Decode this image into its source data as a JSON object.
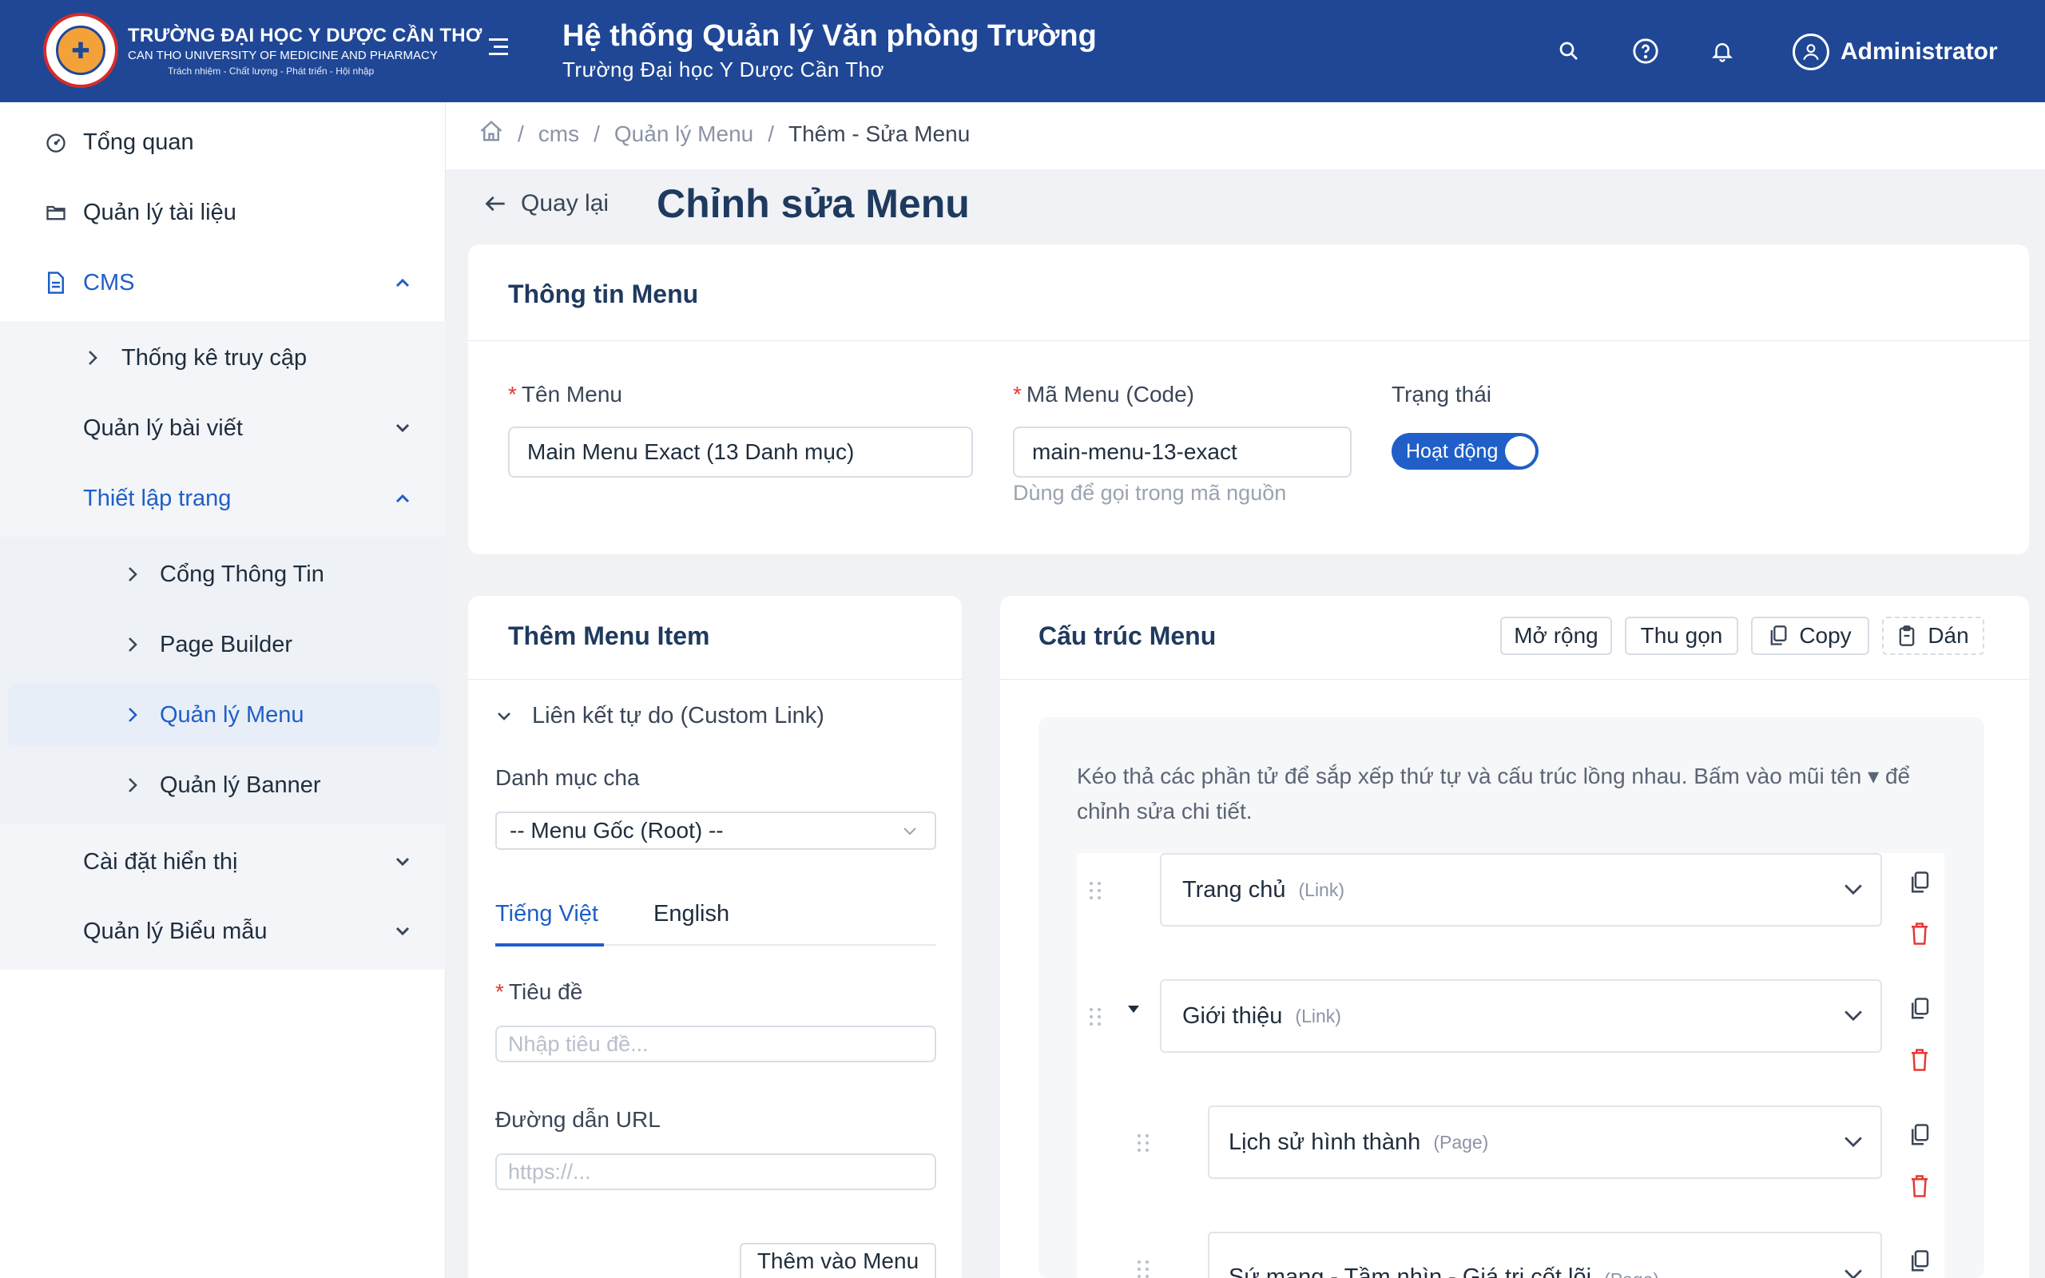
{
  "header": {
    "logo": {
      "line1": "TRƯỜNG ĐẠI HỌC Y DƯỢC CẦN THƠ",
      "line2": "CAN THO UNIVERSITY OF MEDICINE AND PHARMACY",
      "line3": "Trách nhiệm - Chất lượng - Phát triển - Hội nhập"
    },
    "title": "Hệ thống Quản lý Văn phòng Trường",
    "subtitle": "Trường Đại học Y Dược Cần Thơ",
    "user": "Administrator",
    "icons": [
      "menu-icon",
      "search-icon",
      "help-icon",
      "bell-icon",
      "user-icon"
    ]
  },
  "sidebar": {
    "items": [
      {
        "label": "Tổng quan",
        "icon": "dashboard-icon"
      },
      {
        "label": "Quản lý tài liệu",
        "icon": "folder-icon"
      },
      {
        "label": "CMS",
        "icon": "document-icon"
      }
    ],
    "cms_children": [
      {
        "label": "Thống kê truy cập"
      },
      {
        "label": "Quản lý bài viết"
      },
      {
        "label": "Thiết lập trang"
      }
    ],
    "page_children": [
      {
        "label": "Cổng Thông Tin"
      },
      {
        "label": "Page Builder"
      },
      {
        "label": "Quản lý Menu"
      },
      {
        "label": "Quản lý Banner"
      }
    ],
    "cms_tail": [
      {
        "label": "Cài đặt hiển thị"
      },
      {
        "label": "Quản lý Biểu mẫu"
      }
    ]
  },
  "breadcrumb": {
    "items": [
      "cms",
      "Quản lý Menu"
    ],
    "current": "Thêm - Sửa Menu",
    "separator": "/"
  },
  "page": {
    "back_label": "Quay lại",
    "title": "Chỉnh sửa Menu"
  },
  "menu_info": {
    "heading": "Thông tin Menu",
    "name_label": "Tên Menu",
    "name_value": "Main Menu Exact (13 Danh mục)",
    "code_label": "Mã Menu (Code)",
    "code_value": "main-menu-13-exact",
    "code_hint": "Dùng để gọi trong mã nguồn",
    "status_label": "Trạng thái",
    "status_value": "Hoạt động",
    "required_mark": "*"
  },
  "add_item": {
    "heading": "Thêm Menu Item",
    "section": "Liên kết tự do (Custom Link)",
    "parent_label": "Danh mục cha",
    "parent_value": "-- Menu Gốc (Root) --",
    "tabs": [
      "Tiếng Việt",
      "English"
    ],
    "title_label": "Tiêu đề",
    "title_placeholder": "Nhập tiêu đề...",
    "url_label": "Đường dẫn URL",
    "url_placeholder": "https://...",
    "add_button": "Thêm vào Menu"
  },
  "structure": {
    "heading": "Cấu trúc Menu",
    "buttons": {
      "expand": "Mở rộng",
      "collapse": "Thu gọn",
      "copy": "Copy",
      "paste": "Dán"
    },
    "note": "Kéo thả các phần tử để sắp xếp thứ tự và cấu trúc lồng nhau. Bấm vào mũi tên ▾ để chỉnh sửa chi tiết.",
    "nodes": [
      {
        "label": "Trang chủ",
        "type": "(Link)",
        "level": 0
      },
      {
        "label": "Giới thiệu",
        "type": "(Link)",
        "level": 0
      },
      {
        "label": "Lịch sử hình thành",
        "type": "(Page)",
        "level": 1
      },
      {
        "label": "Sứ mạng - Tầm nhìn - Giá trị cốt lõi",
        "type": "(Page)",
        "level": 1
      }
    ]
  },
  "colors": {
    "header_bg": "#1f4796",
    "accent": "#1f5fc7",
    "danger": "#e53935"
  }
}
